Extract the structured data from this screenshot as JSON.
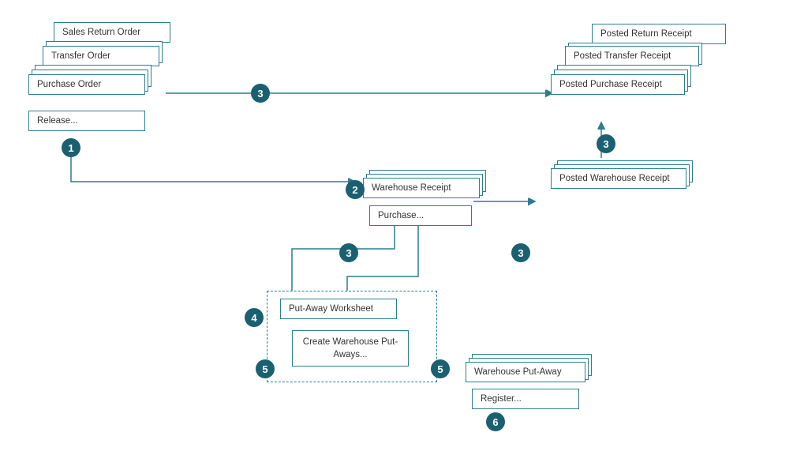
{
  "boxes": {
    "sales_return_order": "Sales Return Order",
    "transfer_order": "Transfer Order",
    "purchase_order": "Purchase Order",
    "release": "Release...",
    "warehouse_receipt": "Warehouse Receipt",
    "purchase_dots": "Purchase...",
    "put_away_worksheet": "Put-Away Worksheet",
    "create_warehouse": "Create Warehouse Put-Aways...",
    "warehouse_put_away": "Warehouse Put-Away",
    "register": "Register...",
    "posted_return_receipt": "Posted Return Receipt",
    "posted_transfer_receipt": "Posted Transfer Receipt",
    "posted_purchase_receipt": "Posted Purchase Receipt",
    "posted_warehouse_receipt": "Posted Warehouse Receipt"
  },
  "badges": {
    "b1": "1",
    "b2": "2",
    "b3a": "3",
    "b3b": "3",
    "b3c": "3",
    "b3d": "3",
    "b4": "4",
    "b5a": "5",
    "b5b": "5",
    "b6": "6"
  }
}
